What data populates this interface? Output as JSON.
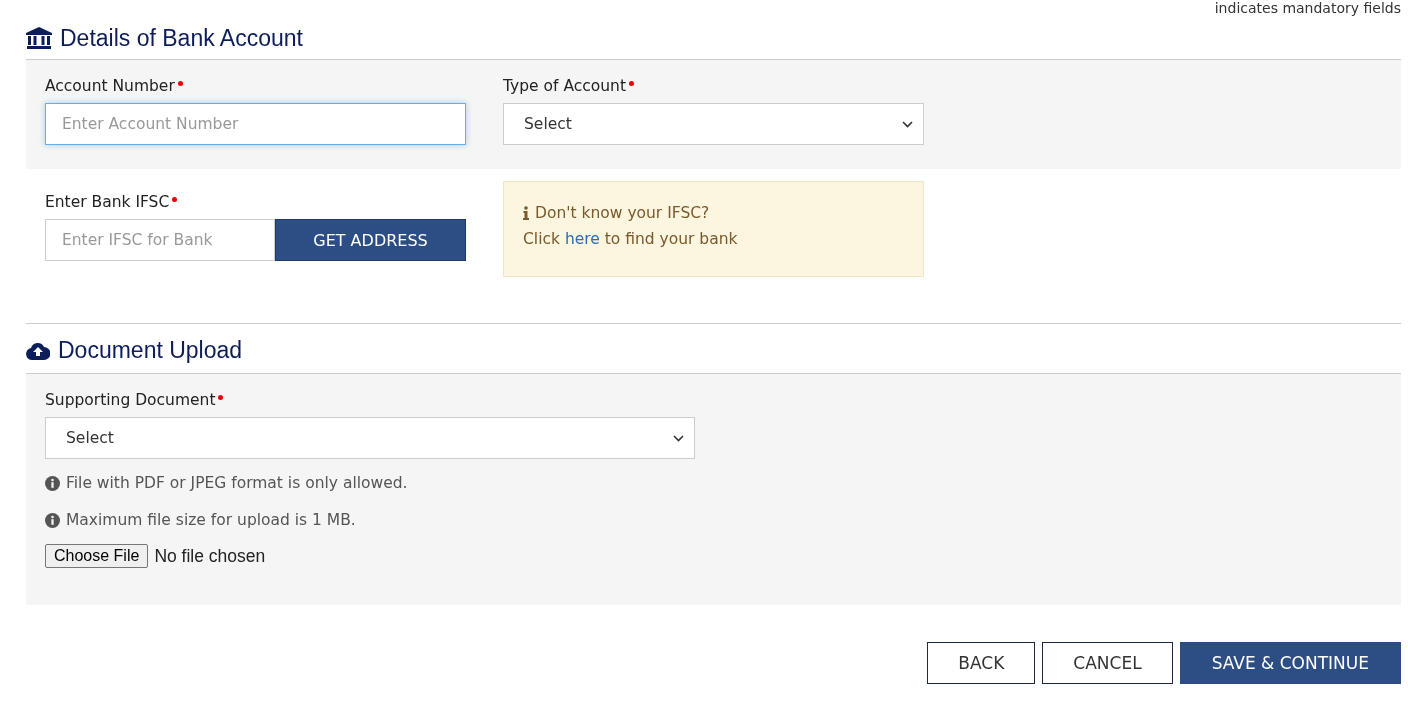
{
  "mandatory_note": "indicates mandatory fields",
  "bank_section": {
    "title": "Details of Bank Account",
    "account_number": {
      "label": "Account Number",
      "required": true,
      "placeholder": "Enter Account Number",
      "focused": true
    },
    "account_type": {
      "label": "Type of Account",
      "required": true,
      "value": "Select"
    },
    "ifsc": {
      "label": "Enter Bank IFSC",
      "required": true,
      "placeholder": "Enter IFSC for Bank",
      "button": "GET ADDRESS"
    },
    "ifsc_help": {
      "title": "Don't know your IFSC?",
      "text_before": "Click",
      "link": "here",
      "text_after": "to find your bank"
    }
  },
  "document_section": {
    "title": "Document Upload",
    "supporting_document": {
      "label": "Supporting Document",
      "required": true,
      "value": "Select"
    },
    "notes": [
      "File with PDF or JPEG format is only allowed.",
      "Maximum file size for upload is 1 MB."
    ],
    "file": {
      "button": "Choose File",
      "status": "No file chosen"
    }
  },
  "buttons": [
    {
      "label": "BACK",
      "kind": "outline"
    },
    {
      "label": "CANCEL",
      "kind": "outline"
    },
    {
      "label": "SAVE & CONTINUE",
      "kind": "primary"
    }
  ]
}
